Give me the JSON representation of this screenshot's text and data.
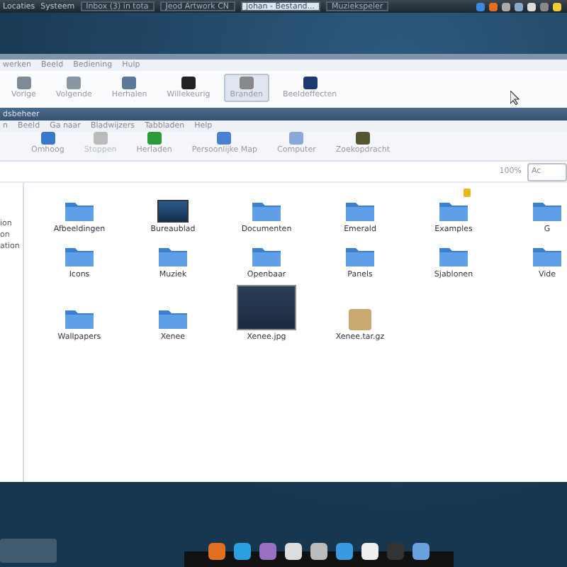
{
  "top_panel": {
    "menus": [
      "Locaties",
      "Systeem"
    ],
    "tasks": [
      {
        "label": "Inbox (3) in tota",
        "selected": false
      },
      {
        "label": "Jeod Artwork CN",
        "selected": false
      },
      {
        "label": "johan - Bestand...",
        "selected": true
      },
      {
        "label": "Muziekspeler",
        "selected": false
      }
    ]
  },
  "viewer_window": {
    "menu": [
      "werken",
      "Beeld",
      "Bediening",
      "Hulp"
    ],
    "toolbar": [
      {
        "label": "Vorige",
        "selected": false
      },
      {
        "label": "Volgende",
        "selected": false
      },
      {
        "label": "Herhalen",
        "selected": false
      },
      {
        "label": "Willekeurig",
        "selected": false
      },
      {
        "label": "Branden",
        "selected": true
      },
      {
        "label": "Beeldeffecten",
        "selected": false
      }
    ]
  },
  "file_manager": {
    "title": "dsbeheer",
    "menu": [
      "n",
      "Beeld",
      "Ga naar",
      "Bladwijzers",
      "Tabbladen",
      "Help"
    ],
    "toolbar": [
      {
        "label": "Omhoog",
        "disabled": false
      },
      {
        "label": "Stoppen",
        "disabled": true
      },
      {
        "label": "Herladen",
        "disabled": false
      },
      {
        "label": "Persoonlijke Map",
        "disabled": false
      },
      {
        "label": "Computer",
        "disabled": false
      },
      {
        "label": "Zoekopdracht",
        "disabled": false
      }
    ],
    "zoom": "100%",
    "location_field": "Ac",
    "sidebar": [
      "ion",
      "on",
      "ation"
    ],
    "items": [
      {
        "name": "Afbeeldingen",
        "kind": "folder",
        "locked": false
      },
      {
        "name": "Bureaublad",
        "kind": "desktop",
        "locked": false
      },
      {
        "name": "Documenten",
        "kind": "folder",
        "locked": false
      },
      {
        "name": "Emerald",
        "kind": "folder",
        "locked": false
      },
      {
        "name": "Examples",
        "kind": "folder",
        "locked": true
      },
      {
        "name": "G",
        "kind": "folder",
        "locked": false
      },
      {
        "name": "Icons",
        "kind": "folder",
        "locked": false
      },
      {
        "name": "Muziek",
        "kind": "folder",
        "locked": false
      },
      {
        "name": "Openbaar",
        "kind": "folder",
        "locked": false
      },
      {
        "name": "Panels",
        "kind": "folder",
        "locked": false
      },
      {
        "name": "Sjablonen",
        "kind": "folder",
        "locked": false
      },
      {
        "name": "Vide",
        "kind": "folder",
        "locked": false
      },
      {
        "name": "Wallpapers",
        "kind": "folder",
        "locked": false
      },
      {
        "name": "Xenee",
        "kind": "folder",
        "locked": false
      },
      {
        "name": "Xenee.jpg",
        "kind": "image",
        "locked": false
      },
      {
        "name": "Xenee.tar.gz",
        "kind": "archive",
        "locked": false
      }
    ]
  }
}
